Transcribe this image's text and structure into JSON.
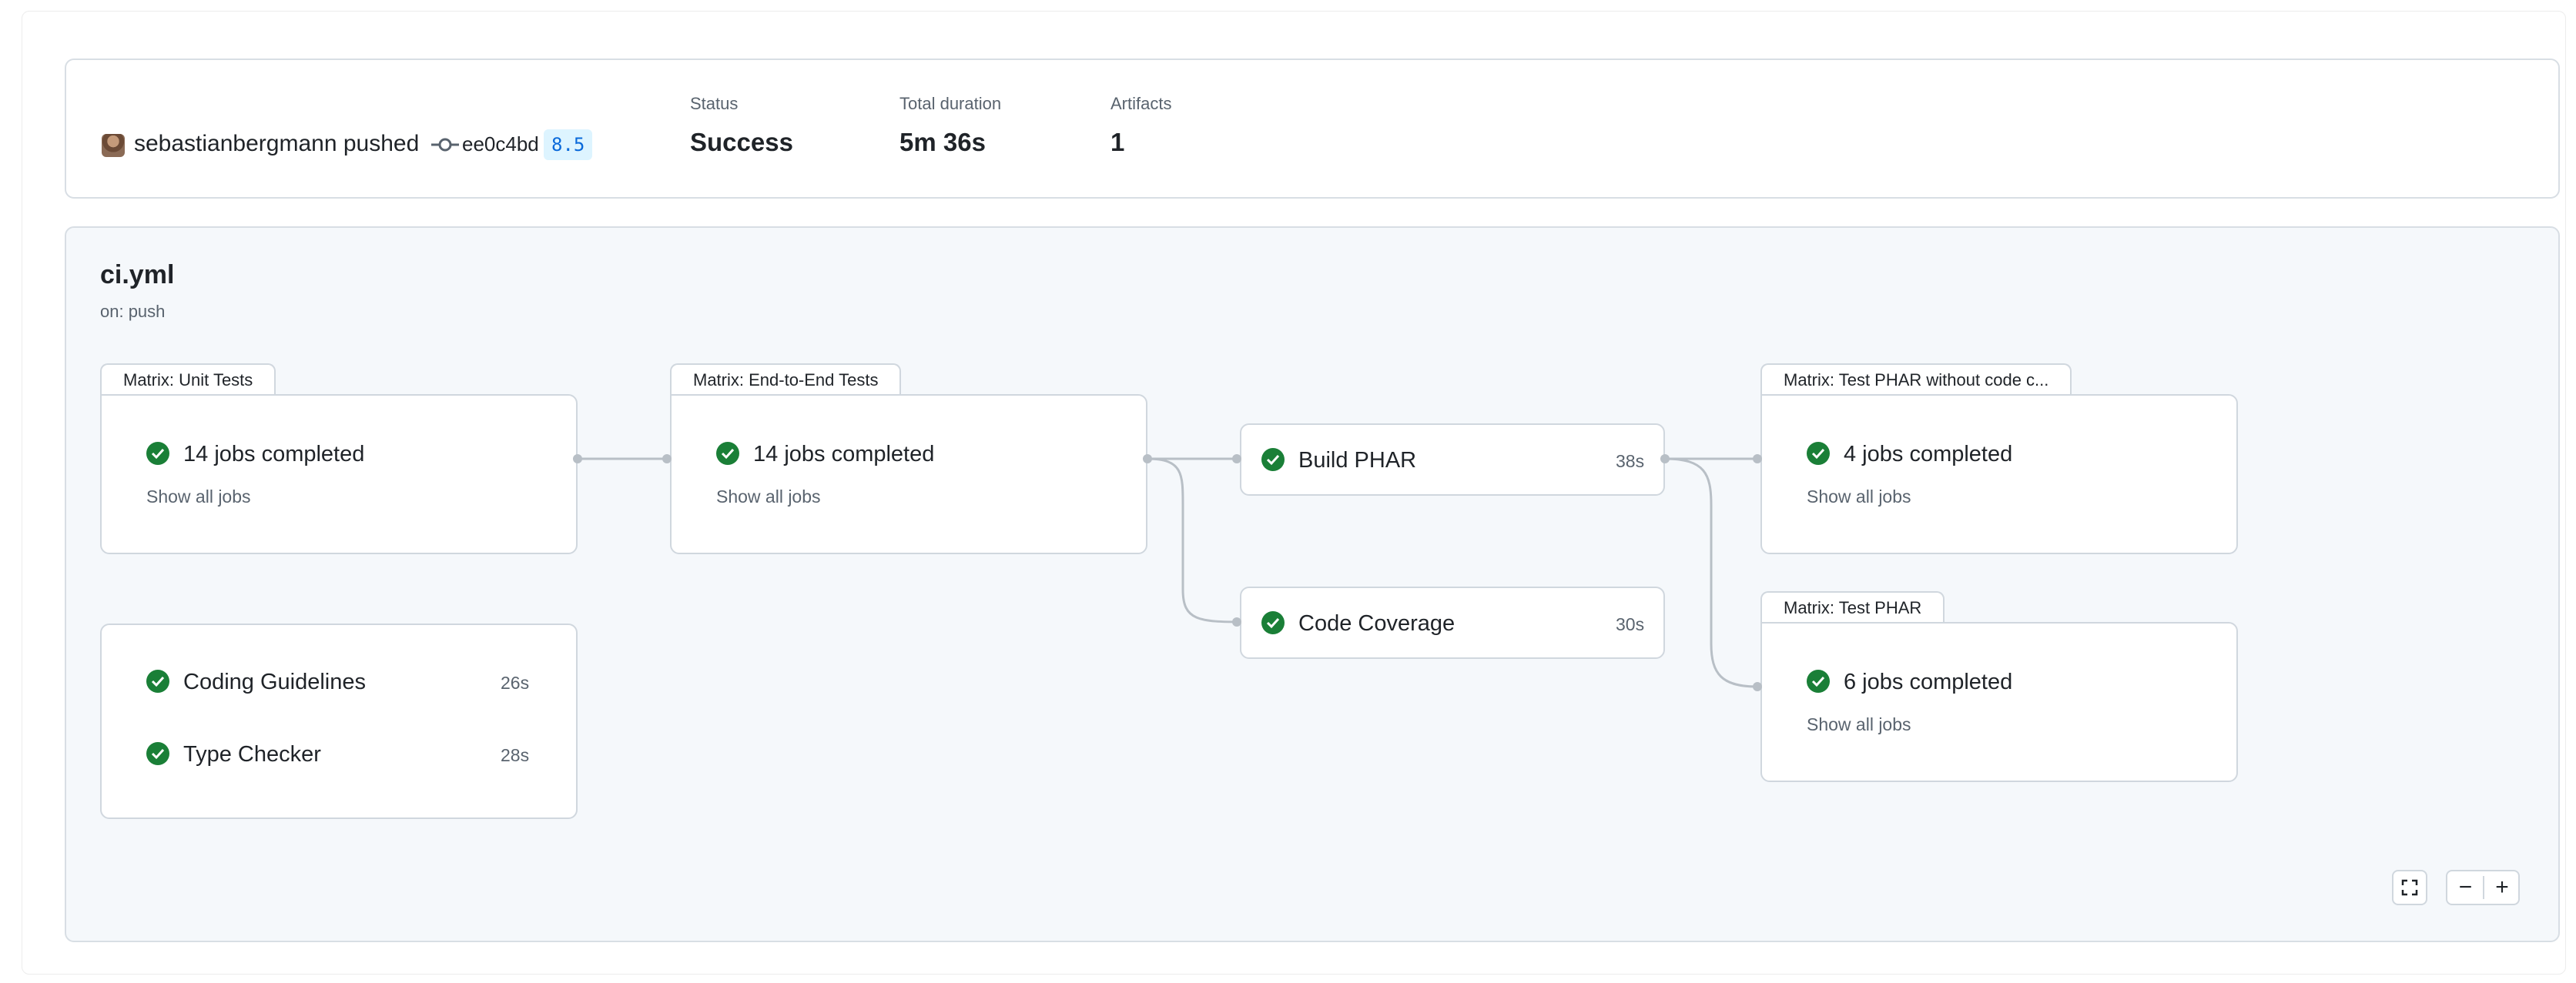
{
  "run": {
    "pusher": "sebastianbergmann pushed",
    "sha": "ee0c4bd",
    "branch": "8.5",
    "stats": [
      {
        "label": "Status",
        "value": "Success"
      },
      {
        "label": "Total duration",
        "value": "5m 36s"
      },
      {
        "label": "Artifacts",
        "value": "1"
      }
    ]
  },
  "workflow": {
    "name": "ci.yml",
    "trigger": "on: push",
    "status_color": "#1a7f37",
    "matrices": [
      {
        "title": "Matrix: Unit Tests",
        "jobs_text": "14 jobs completed",
        "show_all": "Show all jobs"
      },
      {
        "title": "Matrix: End-to-End Tests",
        "jobs_text": "14 jobs completed",
        "show_all": "Show all jobs"
      },
      {
        "title": "Matrix: Test PHAR without code c...",
        "jobs_text": "4 jobs completed",
        "show_all": "Show all jobs"
      },
      {
        "title": "Matrix: Test PHAR",
        "jobs_text": "6 jobs completed",
        "show_all": "Show all jobs"
      }
    ],
    "jobs": [
      {
        "name": "Build PHAR",
        "duration": "38s"
      },
      {
        "name": "Code Coverage",
        "duration": "30s"
      },
      {
        "name": "Coding Guidelines",
        "duration": "26s"
      },
      {
        "name": "Type Checker",
        "duration": "28s"
      }
    ]
  },
  "controls": {
    "fullscreen_icon": "fullscreen-icon",
    "zoom_out_label": "−",
    "zoom_in_label": "+"
  }
}
